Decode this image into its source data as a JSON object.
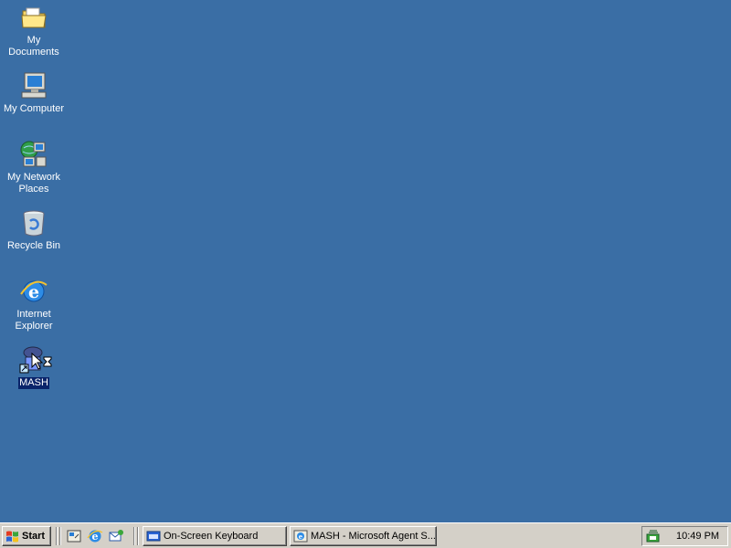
{
  "desktop": {
    "background": "#3a6ea5",
    "icons": [
      {
        "label": "My Documents",
        "icon": "my-documents-folder-icon"
      },
      {
        "label": "My Computer",
        "icon": "my-computer-icon"
      },
      {
        "label": "My Network\nPlaces",
        "icon": "network-places-icon"
      },
      {
        "label": "Recycle Bin",
        "icon": "recycle-bin-icon"
      },
      {
        "label": "Internet\nExplorer",
        "icon": "internet-explorer-icon"
      },
      {
        "label": "MASH",
        "icon": "mash-shortcut-icon",
        "selected": true
      }
    ]
  },
  "taskbar": {
    "start_label": "Start",
    "quick_launch": [
      "show-desktop-icon",
      "internet-explorer-icon",
      "outlook-express-icon"
    ],
    "tasks": [
      {
        "label": "On-Screen Keyboard",
        "icon": "keyboard-icon"
      },
      {
        "label": "MASH - Microsoft Agent S...",
        "icon": "mash-app-icon"
      }
    ],
    "tray_icon": "tray-status-icon",
    "clock": "10:49 PM"
  }
}
